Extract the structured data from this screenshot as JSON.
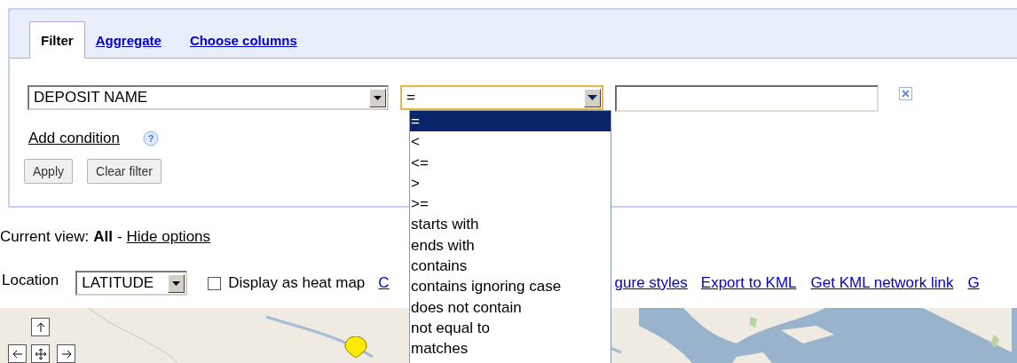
{
  "tabs": [
    {
      "label": "Filter",
      "selected": true
    },
    {
      "label": "Aggregate",
      "selected": false
    },
    {
      "label": "Choose columns",
      "selected": false
    }
  ],
  "condition": {
    "column": "DEPOSIT NAME",
    "operator": "="
  },
  "help_glyph": "?",
  "operator_options": [
    {
      "label": "=",
      "selected": true
    },
    {
      "label": "<",
      "selected": false
    },
    {
      "label": "<=",
      "selected": false
    },
    {
      "label": ">",
      "selected": false
    },
    {
      "label": ">=",
      "selected": false
    },
    {
      "label": "starts with",
      "selected": false
    },
    {
      "label": "ends with",
      "selected": false
    },
    {
      "label": "contains",
      "selected": false
    },
    {
      "label": "contains ignoring case",
      "selected": false
    },
    {
      "label": "does not contain",
      "selected": false
    },
    {
      "label": "not equal to",
      "selected": false
    },
    {
      "label": "matches",
      "selected": false
    }
  ],
  "add_condition": "Add condition",
  "buttons": [
    "Apply",
    "Clear filter"
  ],
  "current_view": {
    "label": "Current view:",
    "value": "All",
    "separator": "-",
    "link": "Hide options"
  },
  "location": {
    "label": "Location",
    "column": "LATITUDE",
    "heat_map_label": "Display as heat map",
    "heat_map": false
  },
  "links": [
    "C",
    "gure styles",
    "Export to KML",
    "Get KML network link",
    "G"
  ]
}
